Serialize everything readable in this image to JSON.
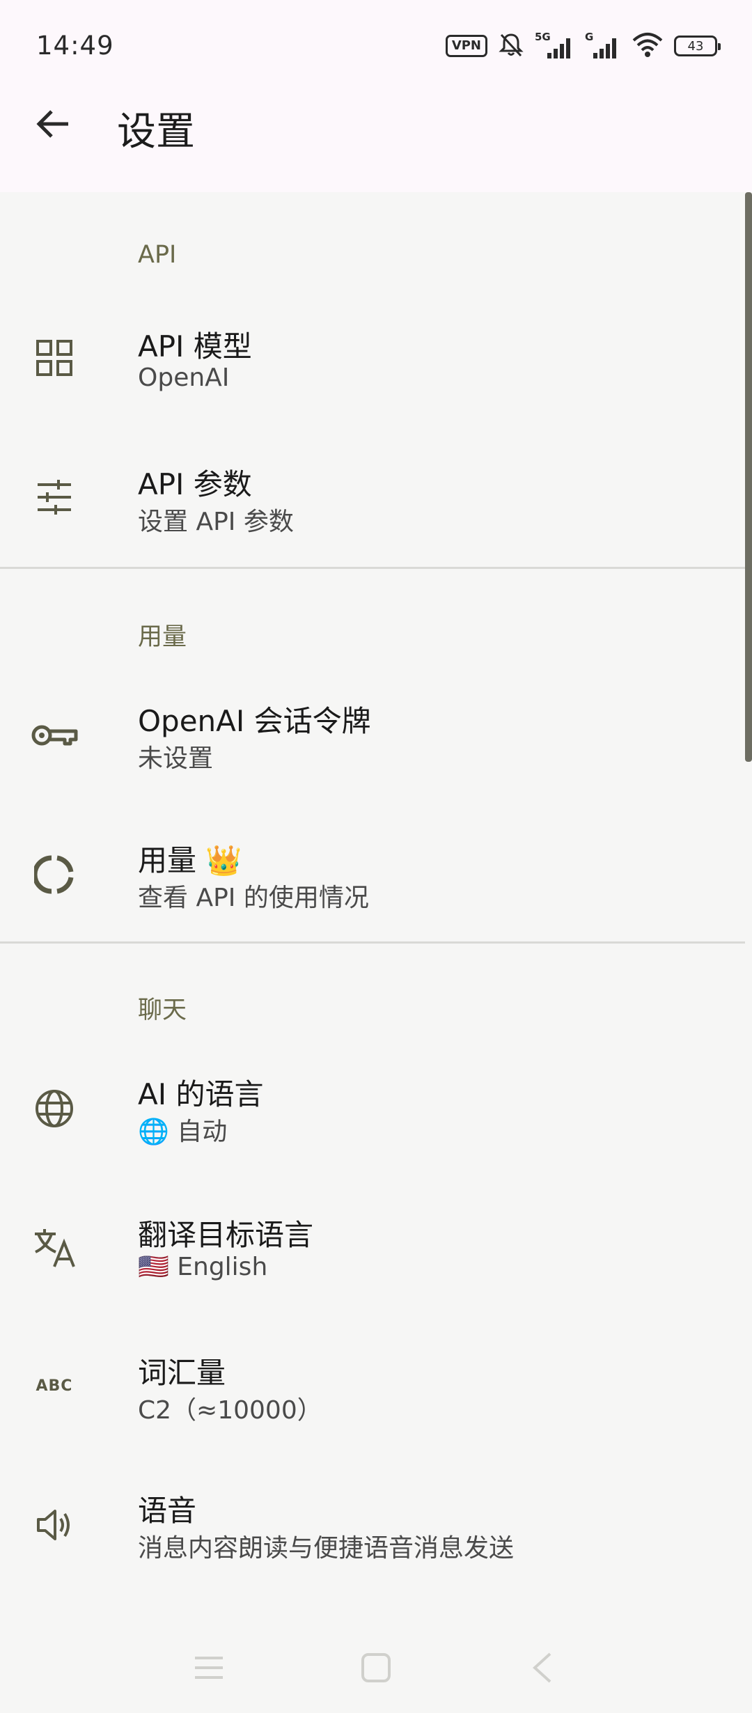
{
  "status_bar": {
    "time": "14:49",
    "vpn_label": "VPN",
    "signal1_label": "5G",
    "signal2_label": "G",
    "battery_level": "43"
  },
  "header": {
    "title": "设置"
  },
  "sections": [
    {
      "header": "API",
      "items": [
        {
          "title": "API 模型",
          "subtitle": "OpenAI",
          "icon": "grid-icon"
        },
        {
          "title": "API 参数",
          "subtitle": "设置 API 参数",
          "icon": "tune-icon"
        }
      ]
    },
    {
      "header": "用量",
      "items": [
        {
          "title": "OpenAI 会话令牌",
          "subtitle": "未设置",
          "icon": "key-icon"
        },
        {
          "title": "用量 👑",
          "subtitle": "查看 API 的使用情况",
          "icon": "donut-icon"
        }
      ]
    },
    {
      "header": "聊天",
      "items": [
        {
          "title": "AI 的语言",
          "subtitle": "🌐 自动",
          "icon": "globe-icon"
        },
        {
          "title": "翻译目标语言",
          "subtitle": "🇺🇸 English",
          "icon": "translate-icon"
        },
        {
          "title": "词汇量",
          "subtitle": "C2（≈10000）",
          "icon": "abc-icon"
        },
        {
          "title": "语音",
          "subtitle": "消息内容朗读与便捷语音消息发送",
          "icon": "speaker-icon"
        }
      ]
    }
  ],
  "colors": {
    "background": "#f6f6f5",
    "app_bar": "#fdf8fc",
    "icon": "#5a5a45",
    "section_header": "#6a6a4a"
  }
}
